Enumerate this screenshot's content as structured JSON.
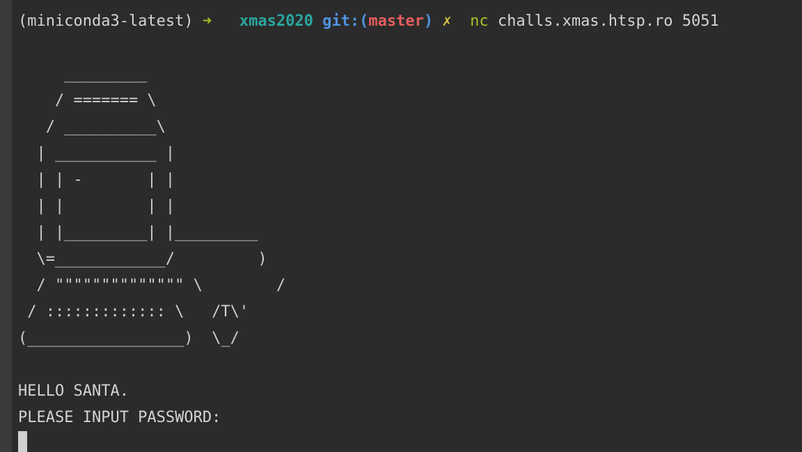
{
  "prompt": {
    "env": "(miniconda3-latest)",
    "arrow": "➜",
    "directory": "xmas2020",
    "git_prefix": "git:(",
    "branch": "master",
    "git_suffix": ")",
    "dirty_mark": "✗",
    "command": "nc",
    "arguments": "challs.xmas.htsp.ro 5051"
  },
  "ascii_art": "     _________\n    / ======= \\\n   / __________\\\n  | ___________ |\n  | | -       | |\n  | |         | |\n  | |_________| |_________\n  \\=____________/         )\n  / \"\"\"\"\"\"\"\"\"\"\"\"\"\" \\        /\n / ::::::::::::: \\   /T\\'\n(_________________)  \\_/",
  "output": {
    "greeting": "HELLO SANTA.",
    "password_prompt": "PLEASE INPUT PASSWORD:"
  }
}
